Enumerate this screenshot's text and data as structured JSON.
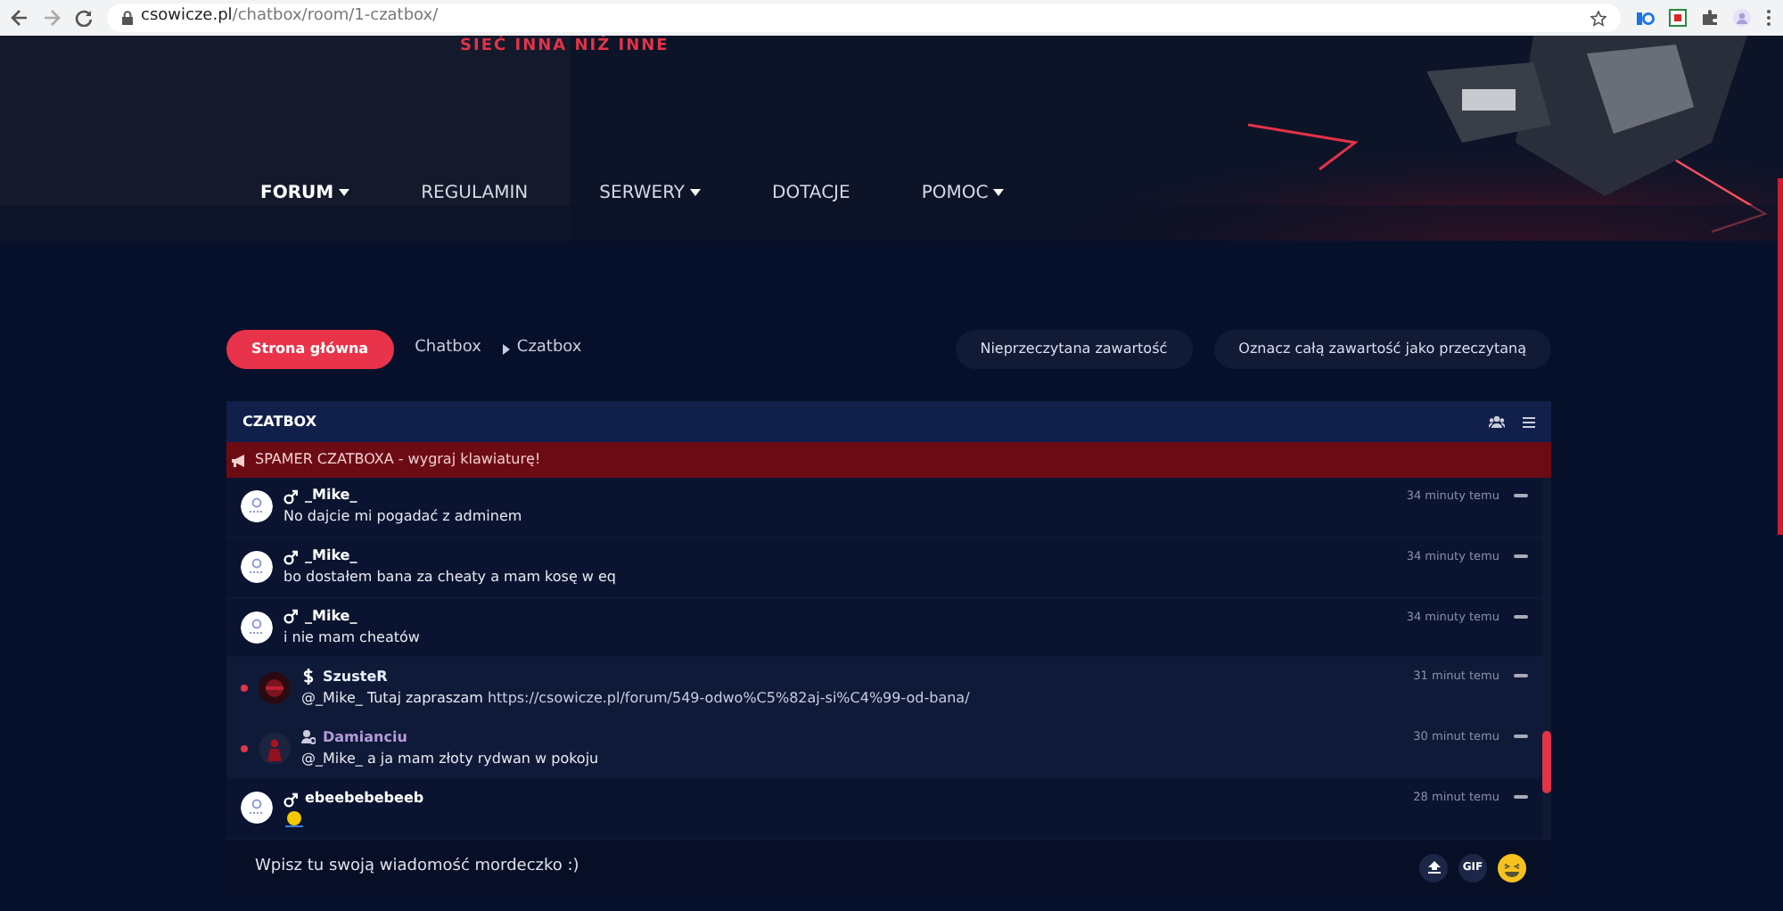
{
  "browser": {
    "url_domain": "csowicze.pl",
    "url_path": "/chatbox/room/1-czatbox/"
  },
  "hero": {
    "tagline": "SIEĆ INNA NIŻ INNE"
  },
  "nav": [
    {
      "label": "FORUM",
      "dropdown": true,
      "selected": true
    },
    {
      "label": "REGULAMIN",
      "dropdown": false,
      "selected": false
    },
    {
      "label": "SERWERY",
      "dropdown": true,
      "selected": false
    },
    {
      "label": "DOTACJE",
      "dropdown": false,
      "selected": false
    },
    {
      "label": "POMOC",
      "dropdown": true,
      "selected": false
    }
  ],
  "breadcrumb": {
    "home": "Strona główna",
    "items": [
      "Chatbox",
      "Czatbox"
    ]
  },
  "actions": [
    "Nieprzeczytana zawartość",
    "Oznacz całą zawartość jako przeczytaną"
  ],
  "chat": {
    "title": "CZATBOX",
    "announcement": "SPAMER CZATBOXA - wygraj klawiaturę!",
    "messages": [
      {
        "user": "_Mike_",
        "kind": "male",
        "color": "#ffffff",
        "unread": false,
        "text": "No dajcie mi pogadać z adminem",
        "time": "34 minuty temu"
      },
      {
        "user": "_Mike_",
        "kind": "male",
        "color": "#ffffff",
        "unread": false,
        "text": "bo dostałem bana za cheaty a mam kosę w eq",
        "time": "34 minuty temu"
      },
      {
        "user": "_Mike_",
        "kind": "male",
        "color": "#ffffff",
        "unread": false,
        "text": "i nie mam cheatów",
        "time": "34 minuty temu"
      },
      {
        "user": "SzusteR",
        "kind": "dollar",
        "color": "#e8f0ff",
        "unread": true,
        "text": "@_Mike_ Tutaj zapraszam",
        "link": "https://csowicze.pl/forum/549-odwo%C5%82aj-si%C4%99-od-bana/",
        "time": "31 minut temu"
      },
      {
        "user": "Damianciu",
        "kind": "admin",
        "color": "#b49ad8",
        "unread": true,
        "text": "@_Mike_ a ja mam złoty rydwan w pokoju",
        "time": "30 minut temu"
      },
      {
        "user": "ebeebebebeeb",
        "kind": "male",
        "color": "#ffffff",
        "unread": false,
        "emoji": true,
        "time": "28 minut temu"
      }
    ],
    "input": {
      "placeholder": "Wpisz tu swoją wiadomość mordeczko :)"
    },
    "gif": "GIF"
  }
}
